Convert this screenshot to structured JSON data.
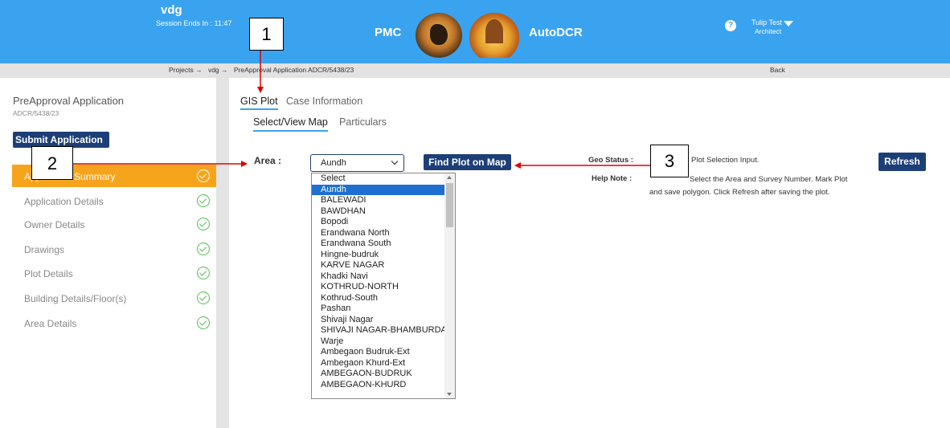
{
  "header": {
    "project": "vdg",
    "session": "Session Ends In : 11:47",
    "org": "PMC",
    "app": "AutoDCR",
    "help_glyph": "?",
    "user_name": "Tulip Test",
    "user_role": "Architect",
    "brand_color": "#3aa3f0"
  },
  "breadcrumb": {
    "items": [
      "Projects →",
      "vdg →",
      "PreApproval Application ADCR/5438/23"
    ],
    "back": "Back"
  },
  "sidebar": {
    "title": "PreApproval Application",
    "subtitle": "ADCR/5438/23",
    "submit": "Submit Application",
    "items": [
      {
        "label": "Application Summary",
        "active": true
      },
      {
        "label": "Application Details",
        "active": false
      },
      {
        "label": "Owner Details",
        "active": false
      },
      {
        "label": "Drawings",
        "active": false
      },
      {
        "label": "Plot Details",
        "active": false
      },
      {
        "label": "Building Details/Floor(s)",
        "active": false
      },
      {
        "label": "Area Details",
        "active": false
      }
    ],
    "accent_color": "#f7a41d"
  },
  "tabs": {
    "main": [
      "GIS Plot",
      "Case Information"
    ],
    "sub": [
      "Select/View Map",
      "Particulars"
    ]
  },
  "form": {
    "area_label": "Area :",
    "area_value": "Aundh",
    "find_button": "Find Plot on Map",
    "geo_label": "Geo Status :",
    "geo_text": "Plot Selection Input.",
    "help_label": "Help Note :",
    "help_text": "Select the Area and Survey Number. Mark Plot and save polygon. Click Refresh after saving the plot.",
    "refresh_button": "Refresh"
  },
  "area_options": [
    "Select",
    "Aundh",
    "BALEWADI",
    "BAWDHAN",
    "Bopodi",
    "Erandwana North",
    "Erandwana South",
    "Hingne-budruk",
    "KARVE NAGAR",
    "Khadki Navi",
    "KOTHRUD-NORTH",
    "Kothrud-South",
    "Pashan",
    "Shivaji Nagar",
    "SHIVAJI NAGAR-BHAMBURDA",
    "Warje",
    "Ambegaon Budruk-Ext",
    "Ambegaon Khurd-Ext",
    "AMBEGAON-BUDRUK",
    "AMBEGAON-KHURD"
  ],
  "selected_option": "Aundh",
  "callouts": [
    "1",
    "2",
    "3"
  ],
  "colors": {
    "button": "#1d3f77",
    "arrow": "#e00000",
    "success": "#52c052"
  }
}
